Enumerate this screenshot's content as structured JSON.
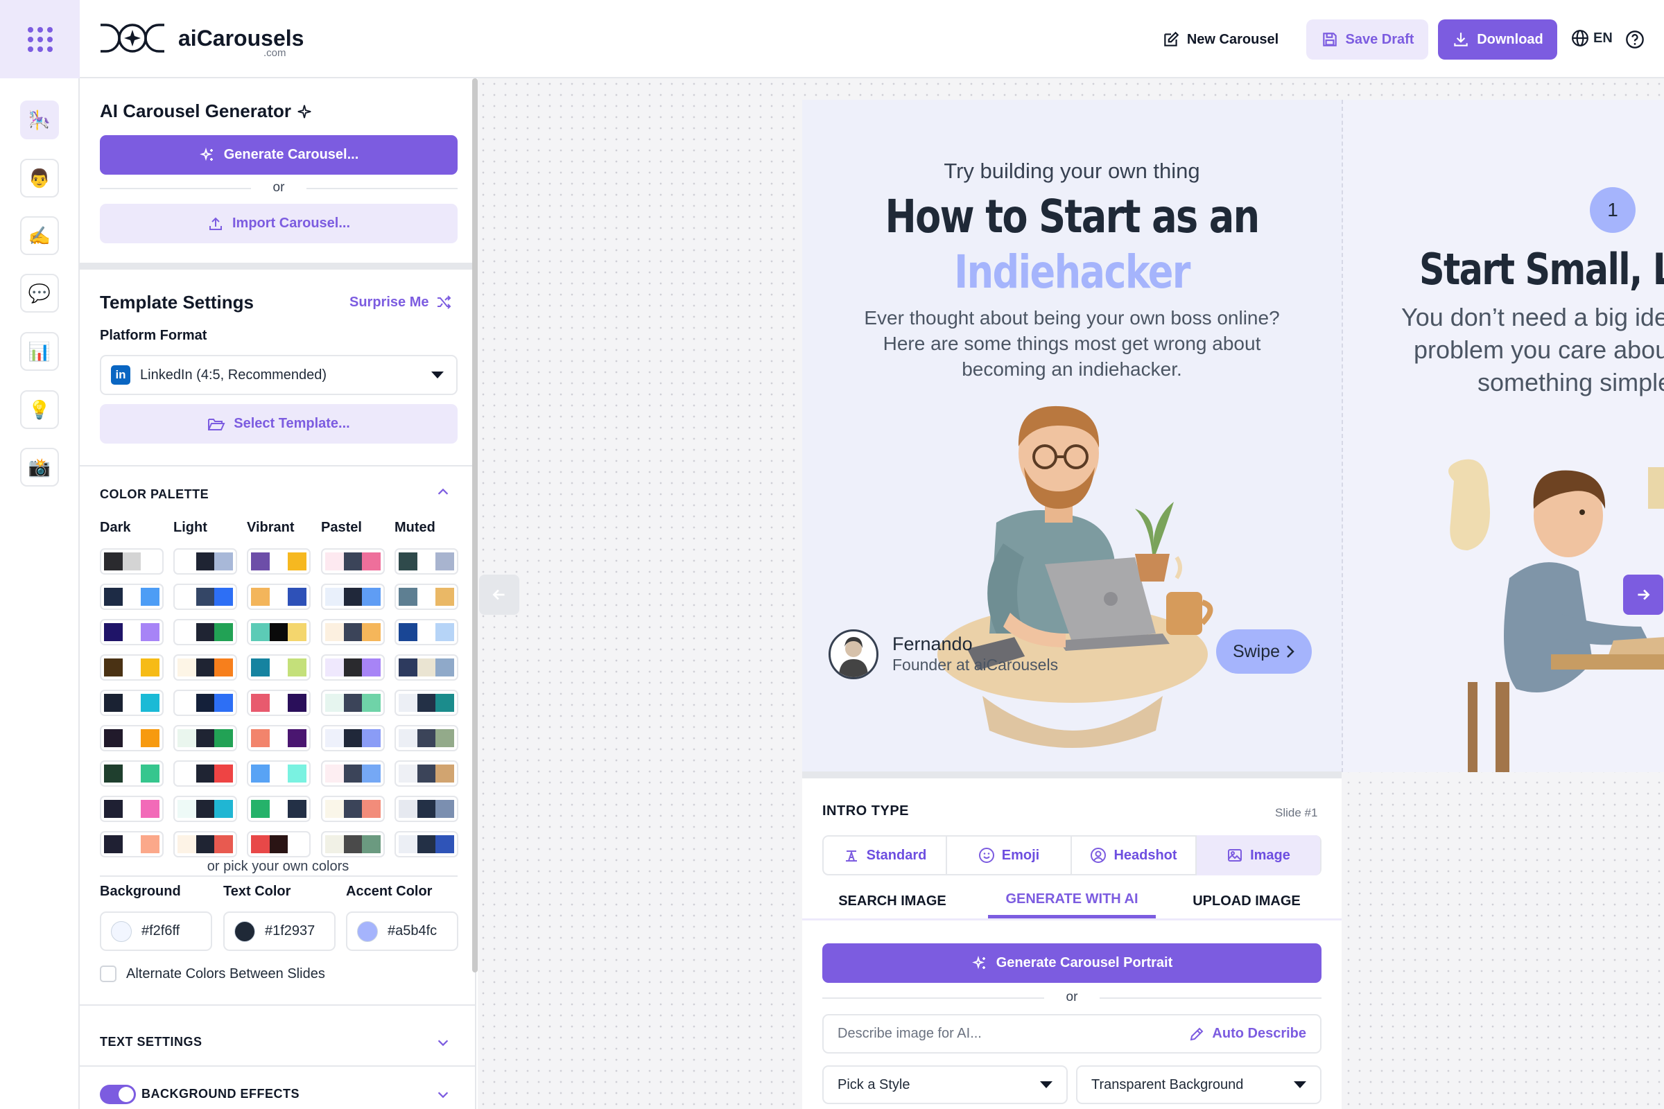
{
  "header": {
    "logo_text": "aiCarousels",
    "logo_sub": ".com",
    "new_carousel": "New Carousel",
    "save_draft": "Save Draft",
    "download": "Download",
    "language": "EN"
  },
  "rail": {
    "icons": [
      "🎠",
      "👨",
      "✍️",
      "💬",
      "📊",
      "💡",
      "📸"
    ]
  },
  "panel": {
    "generator_title": "AI Carousel Generator",
    "generate_button": "Generate Carousel...",
    "or": "or",
    "import_button": "Import Carousel...",
    "template_title": "Template Settings",
    "surprise_me": "Surprise Me",
    "platform_label": "Platform Format",
    "platform_value": "LinkedIn (4:5, Recommended)",
    "select_template": "Select Template...",
    "color_palette_label": "COLOR PALETTE",
    "palette_columns": [
      "Dark",
      "Light",
      "Vibrant",
      "Pastel",
      "Muted"
    ],
    "pick_own": "or pick your own colors",
    "background_label": "Background",
    "text_color_label": "Text Color",
    "accent_color_label": "Accent Color",
    "background_value": "#f2f6ff",
    "text_color_value": "#1f2937",
    "accent_color_value": "#a5b4fc",
    "alternate_label": "Alternate Colors Between Slides",
    "text_settings_label": "TEXT SETTINGS",
    "background_effects_label": "BACKGROUND EFFECTS"
  },
  "palettes": [
    [
      [
        "#2a2a2e",
        "#d4d4d4",
        "#ffffff"
      ],
      [
        "#ffffff",
        "#1f2433",
        "#a8b8d8"
      ],
      [
        "#6d4ea8",
        "#ffffff",
        "#f6b820"
      ],
      [
        "#fde9f0",
        "#3b4459",
        "#ee6f9b"
      ],
      [
        "#2f4a4b",
        "#ffffff",
        "#a8b4cf"
      ]
    ],
    [
      [
        "#1d2b45",
        "#ffffff",
        "#4d9df5"
      ],
      [
        "#ffffff",
        "#344666",
        "#2d6ff5"
      ],
      [
        "#f3b55b",
        "#ffffff",
        "#2e51b8"
      ],
      [
        "#e9f0fb",
        "#20283a",
        "#5f9df4"
      ],
      [
        "#5e7f92",
        "#ffffff",
        "#eab866"
      ]
    ],
    [
      [
        "#1f1468",
        "#ffffff",
        "#a784f6"
      ],
      [
        "#ffffff",
        "#1f2433",
        "#22a255"
      ],
      [
        "#5ccbb6",
        "#0a0a0a",
        "#f4d66d"
      ],
      [
        "#fcf0e0",
        "#3b4459",
        "#f5b65a"
      ],
      [
        "#194695",
        "#ffffff",
        "#b6d4f7"
      ]
    ],
    [
      [
        "#4a3214",
        "#ffffff",
        "#f6bb16"
      ],
      [
        "#fdf5e6",
        "#1f2433",
        "#f77f1c"
      ],
      [
        "#1683a0",
        "#ffffff",
        "#c4e07a"
      ],
      [
        "#efe8fd",
        "#2a2a2e",
        "#a784f6"
      ],
      [
        "#2d3a5e",
        "#eae4d2",
        "#8fa9c9"
      ]
    ],
    [
      [
        "#1a2233",
        "#ffffff",
        "#1bbad6"
      ],
      [
        "#ffffff",
        "#14203a",
        "#2d6ff5"
      ],
      [
        "#e85a6e",
        "#ffffff",
        "#2a0f5a"
      ],
      [
        "#e6f5ef",
        "#3b4459",
        "#6fd3a8"
      ],
      [
        "#eceff5",
        "#233046",
        "#1b8c8c"
      ]
    ],
    [
      [
        "#211a2b",
        "#ffffff",
        "#f79a0f"
      ],
      [
        "#eaf6ee",
        "#1f2433",
        "#22a255"
      ],
      [
        "#f2846c",
        "#ffffff",
        "#4a1670"
      ],
      [
        "#eef1fb",
        "#20283a",
        "#8a9cf6"
      ],
      [
        "#eceff5",
        "#3b4459",
        "#93aa8a"
      ]
    ],
    [
      [
        "#1f3f2e",
        "#ffffff",
        "#36c68e"
      ],
      [
        "#ffffff",
        "#1f2433",
        "#ee4444"
      ],
      [
        "#58a3f5",
        "#ffffff",
        "#7af2e1"
      ],
      [
        "#fdeef2",
        "#3b4459",
        "#75a8f5"
      ],
      [
        "#eef0f5",
        "#3b4459",
        "#d1a470"
      ]
    ],
    [
      [
        "#1f2033",
        "#ffffff",
        "#f26ab8"
      ],
      [
        "#eefaf7",
        "#1f2433",
        "#20b6d3"
      ],
      [
        "#25b26a",
        "#ffffff",
        "#233046"
      ],
      [
        "#faf6e9",
        "#3b4459",
        "#f28c7a"
      ],
      [
        "#e6e9f0",
        "#233046",
        "#7b8fb0"
      ]
    ],
    [
      [
        "#1f2033",
        "#ffffff",
        "#fba88a"
      ],
      [
        "#fdf3e6",
        "#1f2433",
        "#e85a50"
      ],
      [
        "#e84848",
        "#2a1414",
        "#ffffff"
      ],
      [
        "#f1f1e6",
        "#4a4a4a",
        "#6b9a80"
      ],
      [
        "#eceff5",
        "#233046",
        "#2f54b8"
      ]
    ]
  ],
  "slides": {
    "s1_kicker": "Try building your own thing",
    "s1_title_line1": "How to Start as an",
    "s1_title_line2": "Indiehacker",
    "s1_body_line1": "Ever thought about being your own boss online?",
    "s1_body_line2": "Here are some things most get wrong about",
    "s1_body_line3": "becoming an indiehacker.",
    "author_name": "Fernando",
    "author_role": "Founder at aiCarousels",
    "swipe": "Swipe",
    "s2_number": "1",
    "s2_title": "Start Small, Learn",
    "s2_body_line1": "You don’t need a big idea.",
    "s2_body_line2": "problem you care about",
    "s2_body_line3": "something simple"
  },
  "editor": {
    "intro_type": "INTRO TYPE",
    "slide_badge": "Slide #1",
    "types": [
      "Standard",
      "Emoji",
      "Headshot",
      "Image"
    ],
    "subtabs": [
      "SEARCH IMAGE",
      "GENERATE WITH AI",
      "UPLOAD IMAGE"
    ],
    "generate_portrait": "Generate Carousel Portrait",
    "or": "or",
    "describe_placeholder": "Describe image for AI...",
    "auto_describe": "Auto Describe",
    "style_select": "Pick a Style",
    "background_select": "Transparent Background"
  },
  "colors": {
    "accent": "#7c5ce0",
    "accent_light": "#ede9fb",
    "highlight": "#a5b4fc"
  }
}
